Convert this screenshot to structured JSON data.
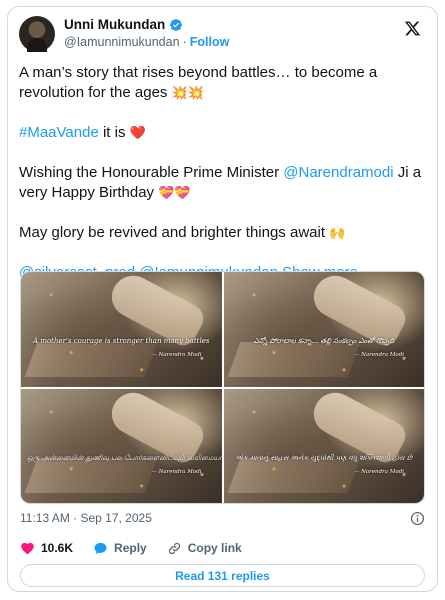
{
  "author": {
    "name": "Unni Mukundan",
    "handle": "@Iamunnimukundan",
    "separator": "·",
    "follow_label": "Follow"
  },
  "tweet": {
    "line1_text": "A man’s story that rises beyond battles… to become a revolution for the ages",
    "line1_emojis": "💥💥",
    "hashtag": "#MaaVande",
    "hashtag_suffix": " it is ",
    "hashtag_emoji": "❤️",
    "wish_prefix": "Wishing the Honourable Prime Minister ",
    "wish_mention": "@Narendramodi",
    "wish_suffix": " Ji a very Happy Birthday ",
    "wish_emojis": "💝💝",
    "glory_text": "May glory be revived and brighter things await ",
    "glory_emoji": "🙌",
    "mention_1": "@silvercast_prod",
    "mention_2": "@Iamunnimukundan",
    "show_more": "Show more"
  },
  "media": {
    "tiles": [
      {
        "quote": "A mother's courage is stronger than many battles",
        "signature": "— Narendra Modi"
      },
      {
        "quote": "ఎన్నో పోరాటాల కన్నా... తల్లి సంకల్పం ఎంతో గొప్పది",
        "signature": "— Narendra Modi"
      },
      {
        "quote": "ஒரு அன்னையின் துணிவு பல போர்களைவிடவும் வலிமையானது",
        "signature": "— Narendra Modi"
      },
      {
        "quote": "એક માતાનું સાહસ અનેક યુદ્ધોથી પણ વધુ શક્તિશાળી હોય છે",
        "signature": "— Narendra Modi"
      }
    ]
  },
  "meta": {
    "timestamp": "11:13 AM · Sep 17, 2025"
  },
  "actions": {
    "likes": "10.6K",
    "reply_label": "Reply",
    "copy_link_label": "Copy link"
  },
  "footer": {
    "read_replies": "Read 131 replies"
  },
  "colors": {
    "accent": "#1d9bf0",
    "like": "#f91880",
    "text": "#0f1419",
    "muted": "#536471",
    "border": "#cfd9de"
  }
}
